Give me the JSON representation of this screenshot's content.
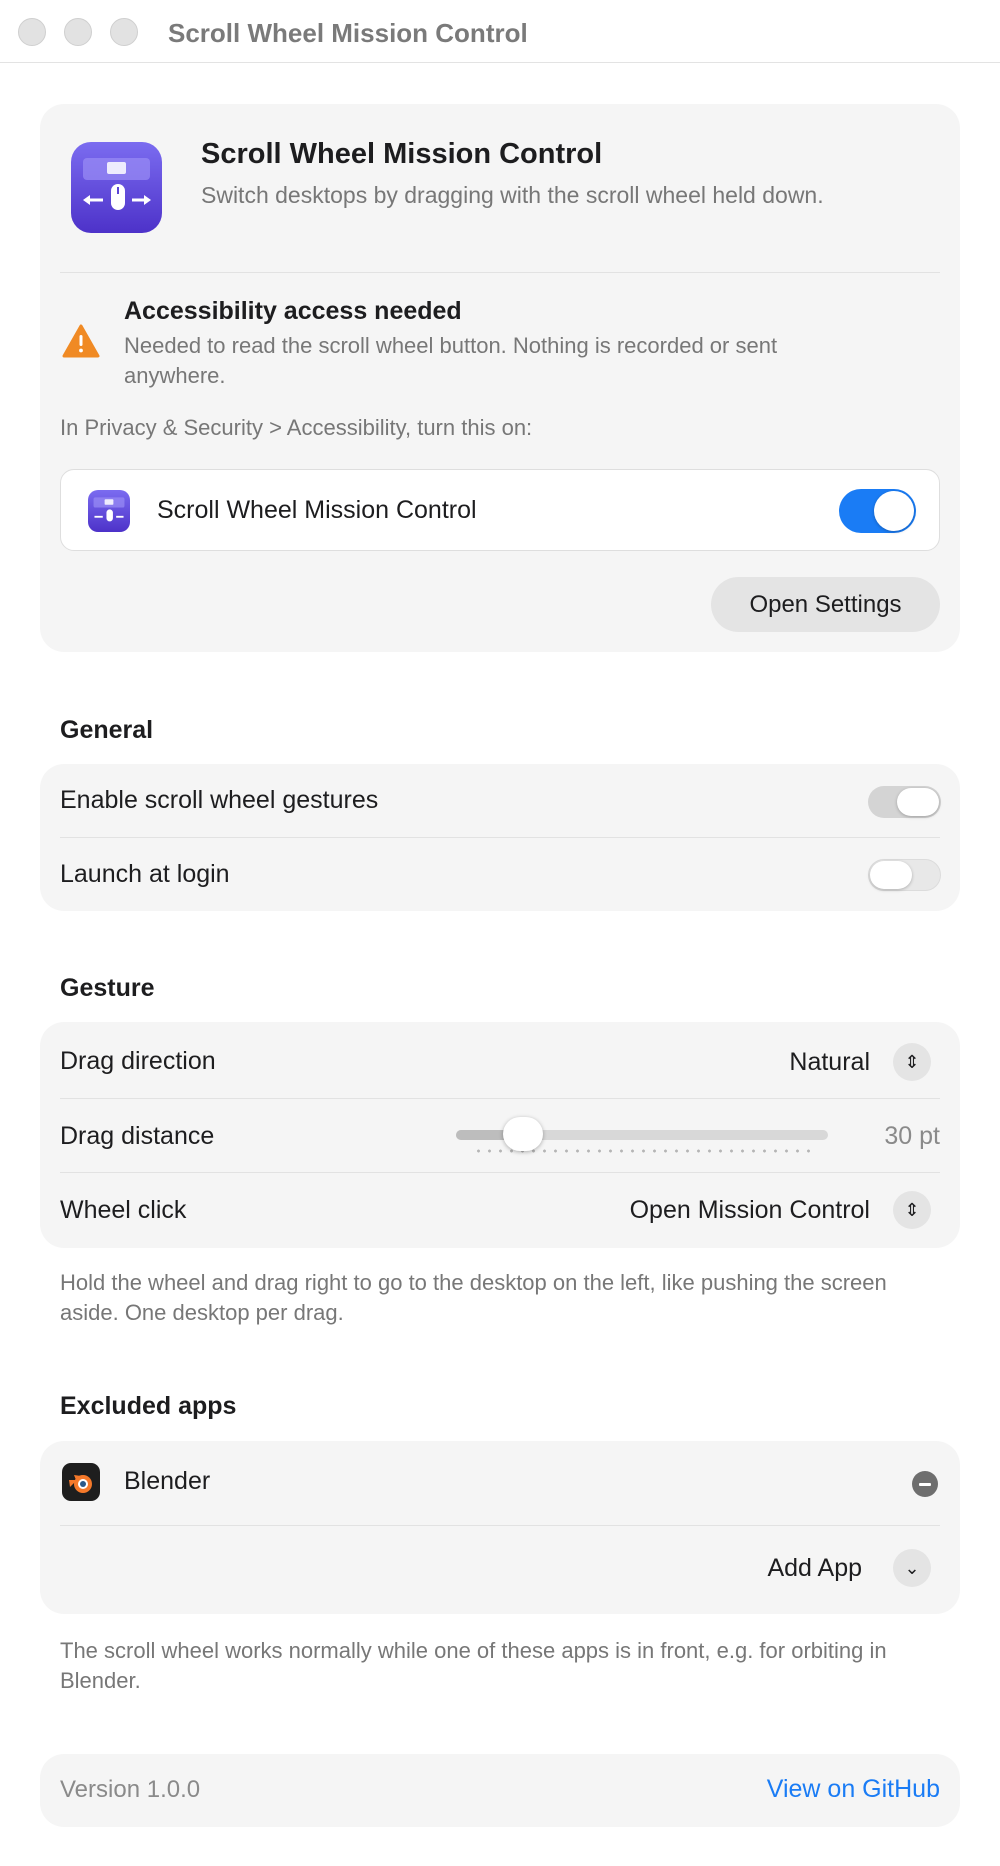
{
  "window": {
    "title": "Scroll Wheel Mission Control"
  },
  "header": {
    "app_name": "Scroll Wheel Mission Control",
    "description": "Switch desktops by dragging with the scroll wheel held down.",
    "warning_title": "Accessibility access needed",
    "warning_text": "Needed to read the scroll wheel button. Nothing is recorded or sent anywhere.",
    "privacy_hint": "In Privacy & Security > Accessibility, turn this on:",
    "permission_app_label": "Scroll Wheel Mission Control",
    "permission_enabled": true,
    "open_settings_label": "Open Settings"
  },
  "general": {
    "title": "General",
    "rows": [
      {
        "label": "Enable scroll wheel gestures",
        "enabled": true
      },
      {
        "label": "Launch at login",
        "enabled": false
      }
    ]
  },
  "gesture": {
    "title": "Gesture",
    "drag_direction_label": "Drag direction",
    "drag_direction_value": "Natural",
    "drag_distance_label": "Drag distance",
    "drag_distance_value": "30 pt",
    "drag_distance_fraction": 0.18,
    "wheel_click_label": "Wheel click",
    "wheel_click_value": "Open Mission Control",
    "footnote": "Hold the wheel and drag right to go to the desktop on the left, like pushing the screen aside. One desktop per drag."
  },
  "excluded": {
    "title": "Excluded apps",
    "apps": [
      {
        "name": "Blender",
        "icon": "blender-icon"
      }
    ],
    "add_app_label": "Add App",
    "footnote": "The scroll wheel works normally while one of these apps is in front, e.g. for orbiting in Blender."
  },
  "footer": {
    "version": "Version 1.0.0",
    "github_link": "View on GitHub"
  },
  "colors": {
    "accent": "#1a7cf5",
    "warning": "#f08a24",
    "app_icon": "#5b45d6"
  }
}
